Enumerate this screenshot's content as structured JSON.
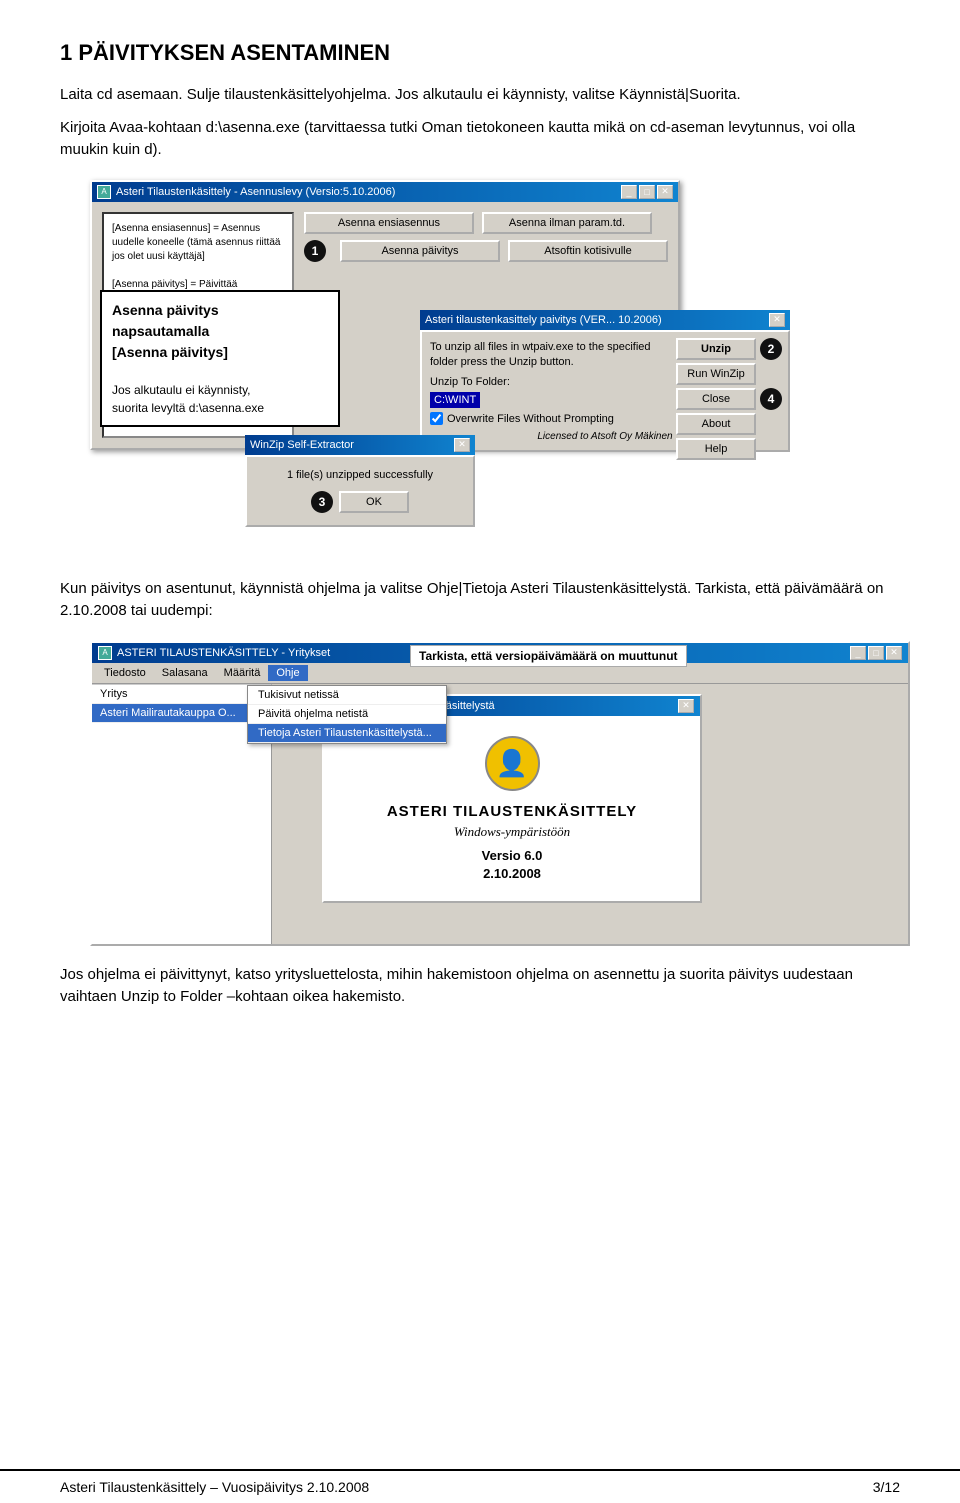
{
  "page": {
    "title": "1 PÄIVITYKSEN ASENTAMINEN",
    "paragraphs": [
      "Laita cd asemaan. Sulje tilaustenkäsittelyohjelma. Jos alkutaulu ei käynnisty, valitse Käynnistä|Suorita.",
      "Kirjoita Avaa-kohtaan d:\\asenna.exe (tarvittaessa tutki Oman tietokoneen kautta mikä on cd-aseman levytunnus, voi olla muukin kuin d)."
    ],
    "para2": "Kun päivitys on asentunut, käynnistä ohjelma ja valitse Ohje|Tietoja Asteri Tilaustenkäsittelystä. Tarkista, että päivämäärä on 2.10.2008 tai uudempi:",
    "para3": "Jos ohjelma ei päivittynyt, katso yritysluettelosta, mihin hakemistoon ohjelma on asennettu ja suorita päivitys uudestaan vaihtaen Unzip to Folder –kohtaan oikea hakemisto."
  },
  "installer_window": {
    "title": "Asteri Tilaustenkäsittely - Asennuslevy (Versio:5.10.2006)",
    "left_text": [
      "[Asenna ensiasennus] = Asennus uudelle koneelle (tämä asennus riittää jos olet uusi käyttäjä]",
      "[Asenna päivitys] = Päivittää uuseimman..."
    ],
    "callout": {
      "line1": "Asenna päivitys",
      "line2": "napsautamalla",
      "line3": "[Asenna päivitys]",
      "line4": "Jos alkutaulu ei käynnisty,",
      "line5": "suorita levyltä d:\\asenna.exe"
    },
    "buttons": {
      "ensiasennus": "Asenna ensiasennus",
      "ilman_param": "Asenna ilman param.td.",
      "paivitys": "Asenna päivitys",
      "kotisivu": "Atsoftin kotisivulle"
    },
    "winzip": {
      "title": "Asteri tilaustenkasittely paivitys (VER... 10.2006)",
      "desc": "To unzip all files in wtpaiv.exe to the specified folder press the Unzip button.",
      "unzip_to_label": "Unzip To Folder:",
      "unzip_to_value": "C:\\WINT",
      "checkbox_label": "Overwrite Files Without Prompting",
      "licensed": "Licensed to Atsoft Oy Mäkinen",
      "buttons": {
        "unzip": "Unzip",
        "run_winzip": "Run WinZip",
        "close": "Close",
        "about": "About",
        "help": "Help"
      }
    },
    "selfex": {
      "title": "WinZip Self-Extractor",
      "message": "1 file(s) unzipped successfully",
      "ok_button": "OK"
    }
  },
  "about_window": {
    "title": "ASTERI TILAUSTENKÄSITTELY - Yritykset",
    "callout": "Tarkista, että versiopäivämäärä on muuttunut",
    "menubar": [
      "Tiedosto",
      "Salasana",
      "Määritä",
      "Ohje"
    ],
    "ohje_menu": {
      "items": [
        "Tukisivut netissä",
        "Päivitä ohjelma netistä",
        "Tietoja Asteri Tilaustenkäsittelystä..."
      ]
    },
    "sidebar": {
      "items": [
        "Yritys",
        "Asteri Mailirautakauppa O..."
      ]
    },
    "about_dialog": {
      "title": "Tietoja Asteri Tilaustenkäsittelystä",
      "product_name": "ASTERI TILAUSTENKÄSITTELY",
      "tagline": "Windows-ympäristöön",
      "version_label": "Versio 6.0",
      "date": "2.10.2008"
    }
  },
  "footer": {
    "left": "Asteri Tilaustenkäsittely – Vuosipäivitys 2.10.2008",
    "right": "3/12"
  },
  "steps": {
    "step1": "1",
    "step2": "2",
    "step3": "3",
    "step4": "4"
  }
}
